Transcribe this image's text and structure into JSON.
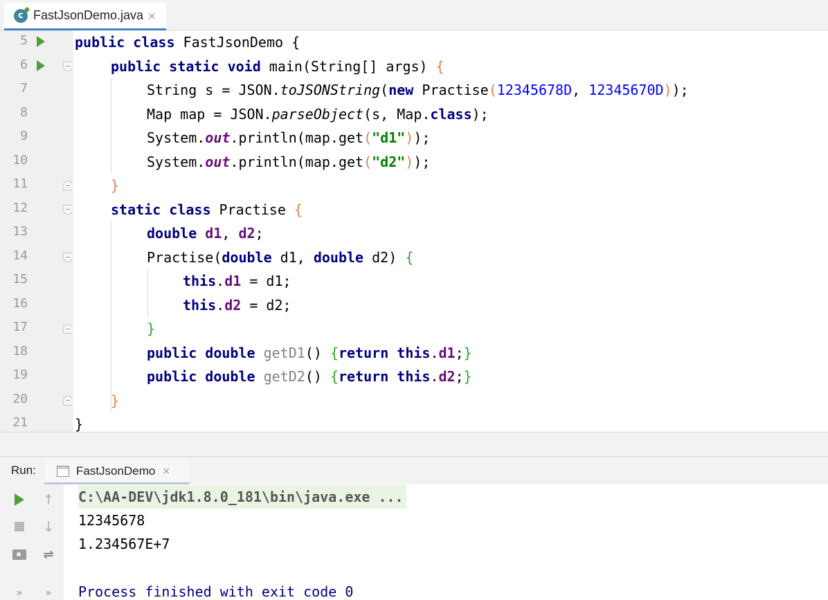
{
  "editor_tab": {
    "icon": "class-icon",
    "icon_letter": "c",
    "label": "FastJsonDemo.java",
    "close": "×"
  },
  "line_numbers": [
    "5",
    "6",
    "7",
    "8",
    "9",
    "10",
    "11",
    "12",
    "13",
    "14",
    "15",
    "16",
    "17",
    "18",
    "19",
    "20",
    "21"
  ],
  "code": {
    "l5": {
      "kw1": "public class",
      "t1": " FastJsonDemo {"
    },
    "l6": {
      "kw1": "public static void",
      "t1": " main(String[] args) ",
      "b1": "{"
    },
    "l7": {
      "t1": "String s = JSON.",
      "m1": "toJSONString",
      "t2": "(",
      "kw1": "new",
      "t3": " Practise",
      "b1": "(",
      "n1": "12345678D",
      "t4": ", ",
      "n2": "12345670D",
      "b2": ")",
      "t5": ");"
    },
    "l8": {
      "t1": "Map map = JSON.",
      "m1": "parseObject",
      "t2": "(s, Map.",
      "kw1": "class",
      "t3": ");"
    },
    "l9": {
      "t1": "System.",
      "f1": "out",
      "t2": ".println(map.get",
      "b1": "(",
      "s1": "\"d1\"",
      "b2": ")",
      "t3": ");"
    },
    "l10": {
      "t1": "System.",
      "f1": "out",
      "t2": ".println(map.get",
      "b1": "(",
      "s1": "\"d2\"",
      "b2": ")",
      "t3": ");"
    },
    "l11": {
      "b1": "}"
    },
    "l12": {
      "kw1": "static class",
      "t1": " Practise ",
      "b1": "{"
    },
    "l13": {
      "kw1": "double",
      "t1": " ",
      "f1": "d1",
      "t2": ", ",
      "f2": "d2",
      "t3": ";"
    },
    "l14": {
      "t1": "Practise(",
      "kw1": "double",
      "t2": " d1, ",
      "kw2": "double",
      "t3": " d2) ",
      "b1": "{"
    },
    "l15": {
      "kw1": "this",
      "t1": ".",
      "f1": "d1",
      "t2": " = d1;"
    },
    "l16": {
      "kw1": "this",
      "t1": ".",
      "f1": "d2",
      "t2": " = d2;"
    },
    "l17": {
      "b1": "}"
    },
    "l18": {
      "kw1": "public double",
      "t1": " ",
      "u1": "getD1",
      "t2": "() ",
      "b1": "{",
      "kw2": "return this",
      "t3": ".",
      "f1": "d1",
      "t4": ";",
      "b2": "}"
    },
    "l19": {
      "kw1": "public double",
      "t1": " ",
      "u1": "getD2",
      "t2": "() ",
      "b1": "{",
      "kw2": "return this",
      "t3": ".",
      "f1": "d2",
      "t4": ";",
      "b2": "}"
    },
    "l20": {
      "b1": "}"
    },
    "l21": {
      "t1": "}"
    }
  },
  "run_panel": {
    "label": "Run:",
    "tab_label": "FastJsonDemo",
    "tab_close": "×",
    "up_arrow": "↑",
    "down_arrow": "↓",
    "wrap_glyph": "⇌",
    "chevron": "»",
    "output": {
      "command": "C:\\AA-DEV\\jdk1.8.0_181\\bin\\java.exe ...",
      "line1": "12345678",
      "line2": "1.234567E+7",
      "finish": "Process finished with exit code 0"
    }
  },
  "colors": {
    "keyword": "#000080",
    "number": "#0000ff",
    "string": "#008000",
    "field": "#660e7a",
    "run_green": "#4c9f3a"
  }
}
